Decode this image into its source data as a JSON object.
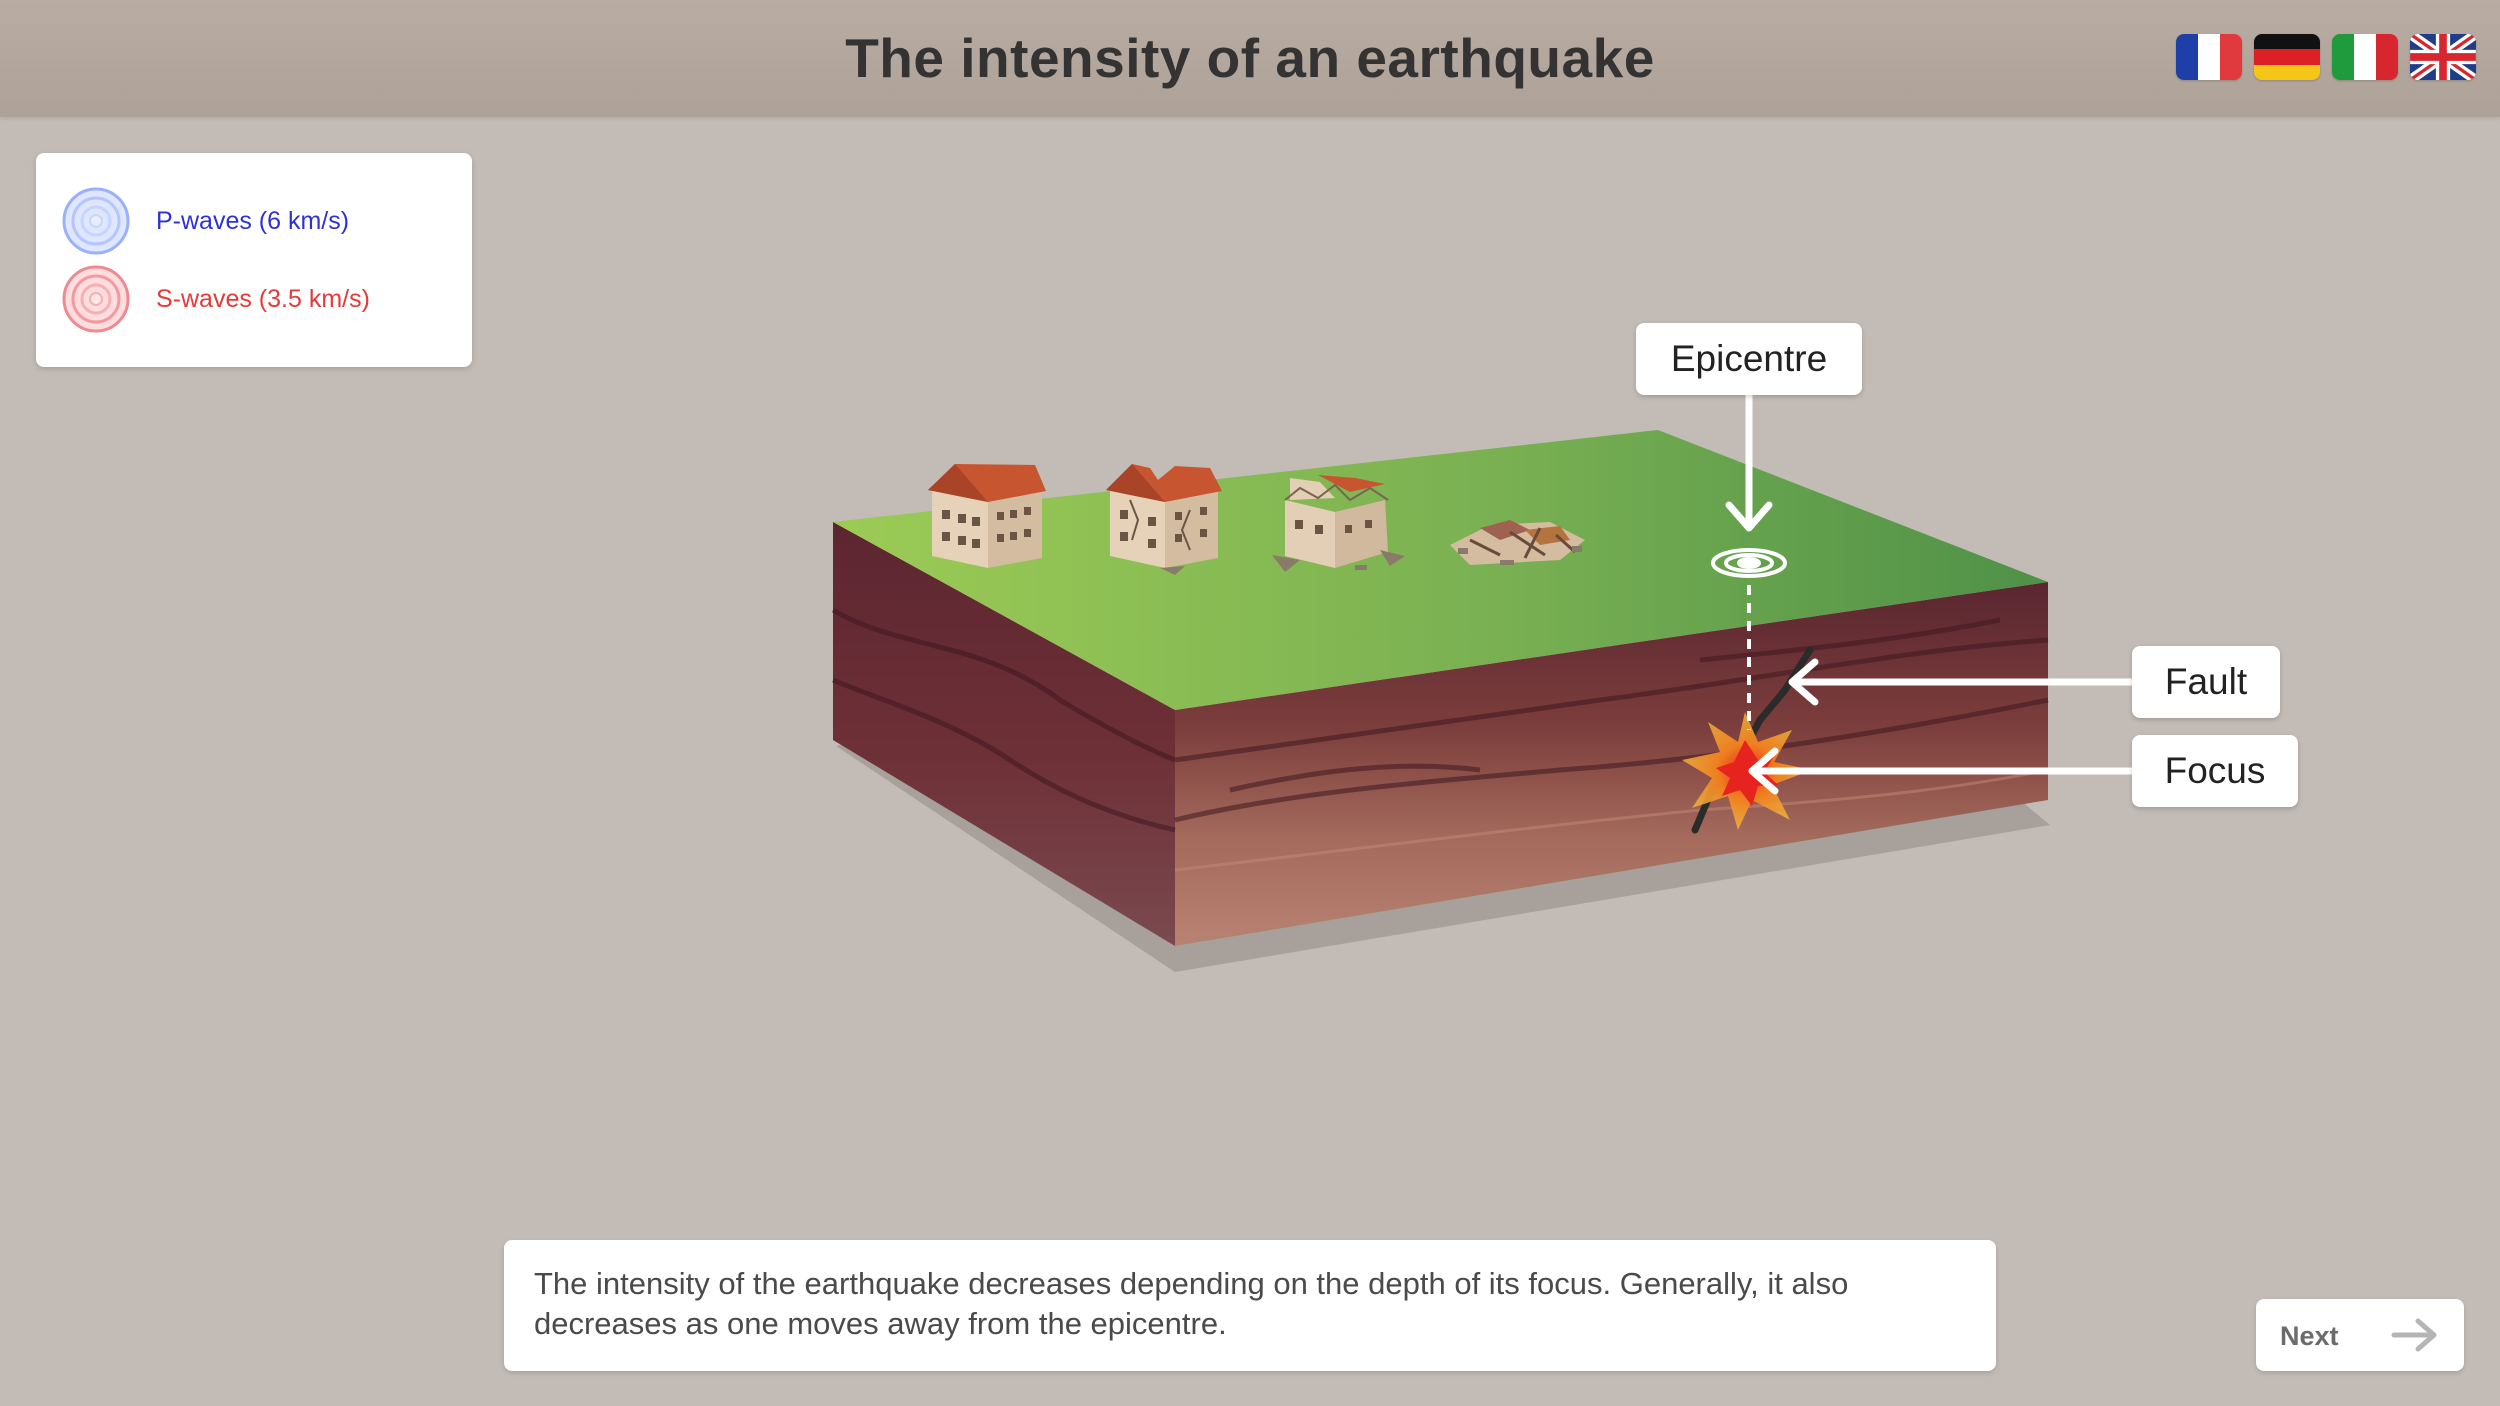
{
  "header": {
    "title": "The intensity of an earthquake"
  },
  "languages": [
    {
      "name": "French flag",
      "colors": [
        "#1f3fa8",
        "#ffffff",
        "#e03a3e"
      ]
    },
    {
      "name": "German flag",
      "colors": [
        "#111111",
        "#dd1f26",
        "#f5c518"
      ]
    },
    {
      "name": "Italian flag",
      "colors": [
        "#1f9a3c",
        "#ffffff",
        "#d8262f"
      ]
    },
    {
      "name": "British flag",
      "colors": [
        "#1f3d8a",
        "#ffffff",
        "#d8262f"
      ]
    }
  ],
  "legend": {
    "p_waves": {
      "label": "P-waves (6 km/s)",
      "color": "#2f31d6"
    },
    "s_waves": {
      "label": "S-waves (3.5 km/s)",
      "color": "#e53a3a"
    }
  },
  "diagram": {
    "epicentre_label": "Epicentre",
    "fault_label": "Fault",
    "focus_label": "Focus"
  },
  "caption": {
    "text": "The intensity of the earthquake decreases depending on the depth of its focus. Generally, it also decreases as one moves away from the epicentre."
  },
  "navigation": {
    "next_label": "Next"
  }
}
